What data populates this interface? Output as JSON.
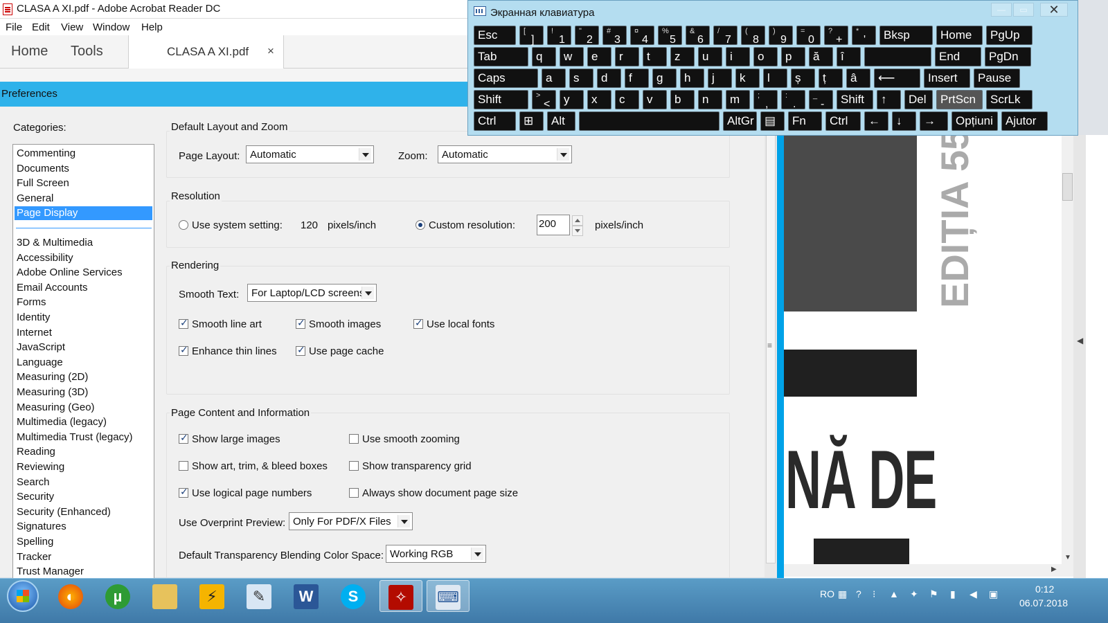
{
  "window": {
    "title": "CLASA A XI.pdf - Adobe Acrobat Reader DC"
  },
  "menu": {
    "items": [
      "File",
      "Edit",
      "View",
      "Window",
      "Help"
    ]
  },
  "tabs": {
    "home": "Home",
    "tools": "Tools",
    "document": "CLASA A XI.pdf",
    "close_glyph": "×"
  },
  "preferences": {
    "title": "Preferences",
    "categories_label": "Categories:",
    "categories_top": [
      "Commenting",
      "Documents",
      "Full Screen",
      "General",
      "Page Display"
    ],
    "selected_category": "Page Display",
    "categories_rest": [
      "3D & Multimedia",
      "Accessibility",
      "Adobe Online Services",
      "Email Accounts",
      "Forms",
      "Identity",
      "Internet",
      "JavaScript",
      "Language",
      "Measuring (2D)",
      "Measuring (3D)",
      "Measuring (Geo)",
      "Multimedia (legacy)",
      "Multimedia Trust (legacy)",
      "Reading",
      "Reviewing",
      "Search",
      "Security",
      "Security (Enhanced)",
      "Signatures",
      "Spelling",
      "Tracker",
      "Trust Manager"
    ],
    "layout_zoom": {
      "title": "Default Layout and Zoom",
      "page_layout_label": "Page Layout:",
      "page_layout_value": "Automatic",
      "zoom_label": "Zoom:",
      "zoom_value": "Automatic"
    },
    "resolution": {
      "title": "Resolution",
      "system_label": "Use system setting:",
      "system_value": "120",
      "system_unit": "pixels/inch",
      "system_selected": false,
      "custom_label": "Custom resolution:",
      "custom_value": "200",
      "custom_unit": "pixels/inch",
      "custom_selected": true
    },
    "rendering": {
      "title": "Rendering",
      "smooth_text_label": "Smooth Text:",
      "smooth_text_value": "For Laptop/LCD screens",
      "smooth_line_art": "Smooth line art",
      "smooth_images": "Smooth images",
      "use_local_fonts": "Use local fonts",
      "enhance_thin_lines": "Enhance thin lines",
      "use_page_cache": "Use page cache"
    },
    "page_content": {
      "title": "Page Content and Information",
      "show_large_images": "Show large images",
      "use_smooth_zooming": "Use smooth zooming",
      "show_art_trim": "Show art, trim, & bleed boxes",
      "show_transparency_grid": "Show transparency grid",
      "use_logical_page_numbers": "Use logical page numbers",
      "always_show_doc_page_size": "Always show document page size",
      "overprint_label": "Use Overprint Preview:",
      "overprint_value": "Only For PDF/X Files",
      "blending_label": "Default Transparency Blending Color Space:",
      "blending_value": "Working RGB"
    }
  },
  "document": {
    "big_text": "NĂ DE",
    "vertical_text": "EDIȚIA 55"
  },
  "osk": {
    "title": "Экранная клавиатура",
    "rows": [
      [
        [
          "Esc",
          ""
        ],
        [
          "]",
          "["
        ],
        [
          "1",
          "!"
        ],
        [
          "2",
          "\""
        ],
        [
          "3",
          "#"
        ],
        [
          "4",
          "¤"
        ],
        [
          "5",
          "%"
        ],
        [
          "6",
          "&"
        ],
        [
          "7",
          "/"
        ],
        [
          "8",
          "("
        ],
        [
          "9",
          ")"
        ],
        [
          "0",
          "="
        ],
        [
          "+",
          "?"
        ],
        [
          "'",
          "*"
        ],
        [
          "Bksp",
          ""
        ],
        [
          "Home",
          ""
        ],
        [
          "PgUp",
          ""
        ]
      ],
      [
        [
          "Tab",
          ""
        ],
        [
          "q",
          ""
        ],
        [
          "w",
          ""
        ],
        [
          "e",
          ""
        ],
        [
          "r",
          ""
        ],
        [
          "t",
          ""
        ],
        [
          "z",
          ""
        ],
        [
          "u",
          ""
        ],
        [
          "i",
          ""
        ],
        [
          "o",
          ""
        ],
        [
          "p",
          ""
        ],
        [
          "ă",
          ""
        ],
        [
          "î",
          ""
        ],
        [
          "",
          ""
        ],
        [
          "End",
          ""
        ],
        [
          "PgDn",
          ""
        ]
      ],
      [
        [
          "Caps",
          ""
        ],
        [
          "a",
          ""
        ],
        [
          "s",
          ""
        ],
        [
          "d",
          ""
        ],
        [
          "f",
          ""
        ],
        [
          "g",
          ""
        ],
        [
          "h",
          ""
        ],
        [
          "j",
          ""
        ],
        [
          "k",
          ""
        ],
        [
          "l",
          ""
        ],
        [
          "ș",
          ""
        ],
        [
          "ț",
          ""
        ],
        [
          "â",
          ""
        ],
        [
          "⟵",
          ""
        ],
        [
          "Insert",
          ""
        ],
        [
          "Pause",
          ""
        ]
      ],
      [
        [
          "Shift",
          ""
        ],
        [
          "<",
          ">"
        ],
        [
          "y",
          ""
        ],
        [
          "x",
          ""
        ],
        [
          "c",
          ""
        ],
        [
          "v",
          ""
        ],
        [
          "b",
          ""
        ],
        [
          "n",
          ""
        ],
        [
          "m",
          ""
        ],
        [
          ",",
          ";"
        ],
        [
          ".",
          ":"
        ],
        [
          "-",
          "_"
        ],
        [
          "Shift",
          ""
        ],
        [
          "↑",
          ""
        ],
        [
          "Del",
          ""
        ],
        [
          "PrtScn",
          ""
        ],
        [
          "ScrLk",
          ""
        ]
      ],
      [
        [
          "Ctrl",
          ""
        ],
        [
          "⊞",
          ""
        ],
        [
          "Alt",
          ""
        ],
        [
          "",
          ""
        ],
        [
          "AltGr",
          ""
        ],
        [
          "▤",
          ""
        ],
        [
          "Fn",
          ""
        ],
        [
          "Ctrl",
          ""
        ],
        [
          "←",
          ""
        ],
        [
          "↓",
          ""
        ],
        [
          "→",
          ""
        ],
        [
          "Opțiuni",
          ""
        ],
        [
          "Ajutor",
          ""
        ]
      ]
    ]
  },
  "taskbar": {
    "lang": "RO",
    "time": "0:12",
    "date": "06.07.2018"
  }
}
